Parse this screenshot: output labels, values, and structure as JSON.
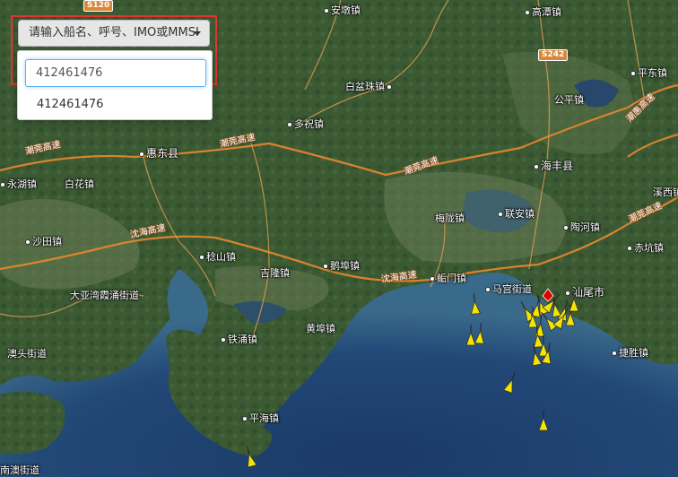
{
  "search": {
    "dropdown_label": "请输入船名、呼号、IMO或MMSI",
    "input_value": "412461476",
    "result": "412461476"
  },
  "map": {
    "places": [
      {
        "name": "安墩镇",
        "kind": "town"
      },
      {
        "name": "高潭镇",
        "kind": "town"
      },
      {
        "name": "白盆珠镇",
        "kind": "town"
      },
      {
        "name": "平东镇",
        "kind": "town"
      },
      {
        "name": "公平镇",
        "kind": "town"
      },
      {
        "name": "多祝镇",
        "kind": "town"
      },
      {
        "name": "惠东县",
        "kind": "county"
      },
      {
        "name": "海丰县",
        "kind": "county"
      },
      {
        "name": "永湖镇",
        "kind": "town"
      },
      {
        "name": "白花镇",
        "kind": "town"
      },
      {
        "name": "梅陇镇",
        "kind": "town"
      },
      {
        "name": "联安镇",
        "kind": "town"
      },
      {
        "name": "陶河镇",
        "kind": "town"
      },
      {
        "name": "沙田镇",
        "kind": "town"
      },
      {
        "name": "稔山镇",
        "kind": "town"
      },
      {
        "name": "赤坑镇",
        "kind": "town"
      },
      {
        "name": "吉隆镇",
        "kind": "town"
      },
      {
        "name": "鲘门镇",
        "kind": "town"
      },
      {
        "name": "马宫街道",
        "kind": "town"
      },
      {
        "name": "汕尾市",
        "kind": "city"
      },
      {
        "name": "大亚湾霞涌街道",
        "kind": "town"
      },
      {
        "name": "铁涌镇",
        "kind": "town"
      },
      {
        "name": "黄埠镇",
        "kind": "town"
      },
      {
        "name": "澳头街道",
        "kind": "town"
      },
      {
        "name": "捷胜镇",
        "kind": "town"
      },
      {
        "name": "平海镇",
        "kind": "town"
      },
      {
        "name": "南澳街道",
        "kind": "town"
      },
      {
        "name": "鹅埠镇",
        "kind": "town"
      },
      {
        "name": "溪西镇",
        "kind": "town"
      }
    ],
    "roads": [
      {
        "name": "潮莞高速"
      },
      {
        "name": "潮莞高速"
      },
      {
        "name": "潮莞高速"
      },
      {
        "name": "沈海高速"
      },
      {
        "name": "沈海高速"
      },
      {
        "name": "潮惠高速"
      },
      {
        "name": "潮莞高速"
      }
    ],
    "shields": [
      "S120",
      "S242"
    ],
    "ship_marker_color": "#f5e400",
    "selected_ship_color": "#e00000",
    "water_color": "#1d3e6b",
    "land_color": "#3d5a36"
  }
}
